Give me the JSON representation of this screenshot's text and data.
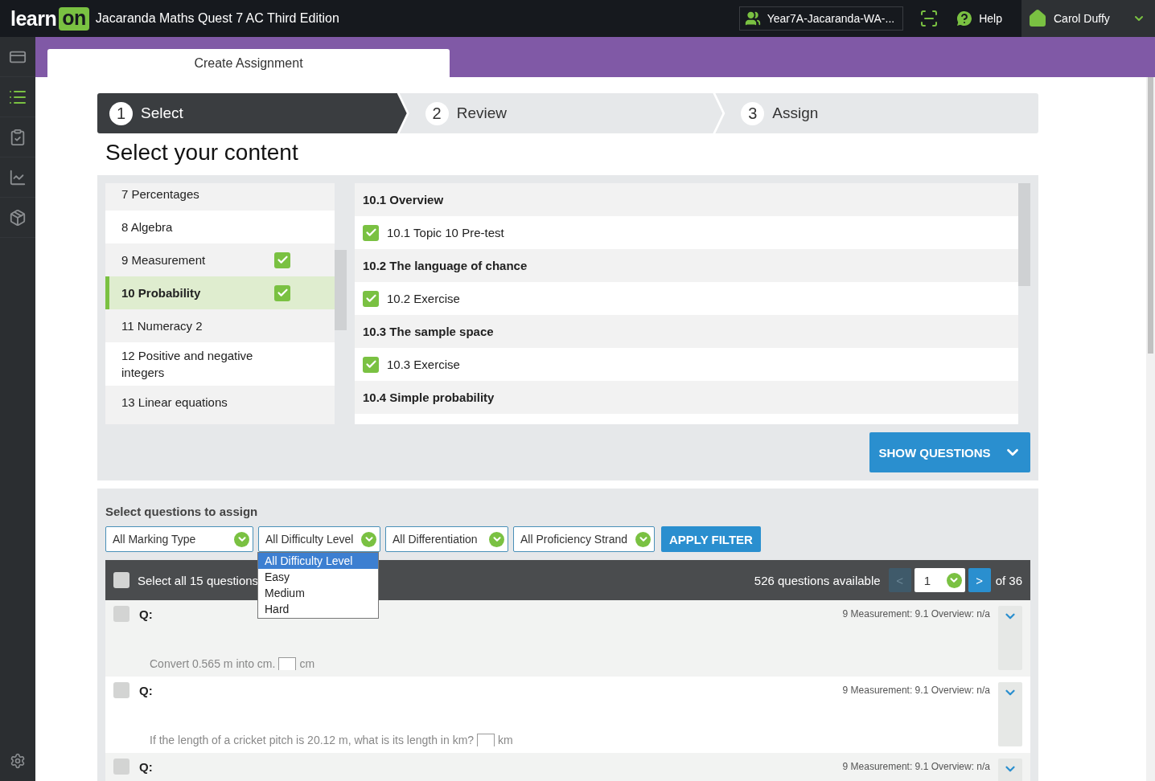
{
  "header": {
    "logo": {
      "word": "learn",
      "badge": "on"
    },
    "title": "Jacaranda Maths Quest 7 AC Third Edition",
    "class_selector": "Year7A-Jacaranda-WA-...",
    "help": "Help",
    "user": "Carol Duffy"
  },
  "page_tab": "Create Assignment",
  "steps": [
    {
      "number": "1",
      "label": "Select",
      "selected": true
    },
    {
      "number": "2",
      "label": "Review",
      "selected": false
    },
    {
      "number": "3",
      "label": "Assign",
      "selected": false
    }
  ],
  "heading": "Select your content",
  "topics": [
    {
      "label": "7 Percentages",
      "checked": false,
      "selected": false
    },
    {
      "label": "8 Algebra",
      "checked": false,
      "selected": false
    },
    {
      "label": "9 Measurement",
      "checked": true,
      "selected": false
    },
    {
      "label": "10 Probability",
      "checked": true,
      "selected": true
    },
    {
      "label": "11 Numeracy 2",
      "checked": false,
      "selected": false
    },
    {
      "label": "12 Positive and negative integers",
      "checked": false,
      "selected": false
    },
    {
      "label": "13 Linear equations",
      "checked": false,
      "selected": false
    }
  ],
  "subtopics": [
    {
      "kind": "section",
      "label": "10.1 Overview"
    },
    {
      "kind": "item",
      "label": "10.1 Topic 10 Pre-test",
      "checked": true
    },
    {
      "kind": "section",
      "label": "10.2 The language of chance"
    },
    {
      "kind": "item",
      "label": "10.2 Exercise",
      "checked": true
    },
    {
      "kind": "section",
      "label": "10.3 The sample space"
    },
    {
      "kind": "item",
      "label": "10.3 Exercise",
      "checked": true
    },
    {
      "kind": "section",
      "label": "10.4 Simple probability"
    }
  ],
  "show_questions": "SHOW QUESTIONS",
  "questions_panel": {
    "title": "Select questions to assign",
    "filters": [
      "All Marking Type",
      "All Difficulty Level",
      "All Differentiation",
      "All Proficiency Strand"
    ],
    "apply": "APPLY FILTER",
    "dropdown": [
      {
        "label": "All Difficulty Level",
        "selected": true
      },
      {
        "label": "Easy",
        "selected": false
      },
      {
        "label": "Medium",
        "selected": false
      },
      {
        "label": "Hard",
        "selected": false
      }
    ],
    "select_all": {
      "label": "Select all 15 questions",
      "checked": false
    },
    "available": "526 questions available",
    "prev": "<",
    "page": "1",
    "next": ">",
    "of": "of 36",
    "questions": [
      {
        "label": "Q:",
        "meta": "9 Measurement: 9.1 Overview: n/a",
        "text": "Convert 0.565 m into cm.",
        "unit": "cm",
        "checked": false
      },
      {
        "label": "Q:",
        "meta": "9 Measurement: 9.1 Overview: n/a",
        "text": "If the length of a cricket pitch is 20.12 m, what is its length in km?",
        "unit": "km",
        "checked": false
      },
      {
        "label": "Q:",
        "meta": "9 Measurement: 9.1 Overview: n/a",
        "checked": false
      }
    ]
  }
}
